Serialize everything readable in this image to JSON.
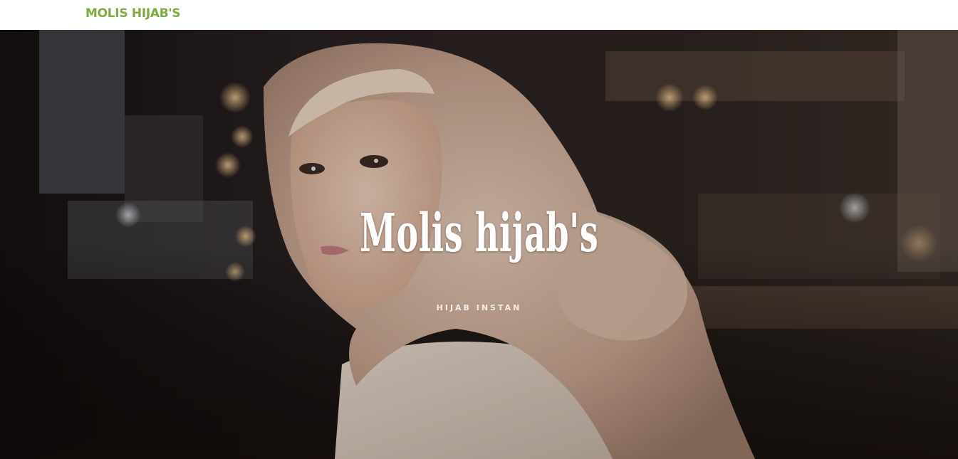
{
  "header": {
    "brand": "MOLIS HIJAB'S",
    "brand_color": "#7cab3e"
  },
  "hero": {
    "title": "Molis hijab's",
    "subtitle": "HIJAB INSTAN",
    "background_image": "woman-in-hijab-photo"
  }
}
